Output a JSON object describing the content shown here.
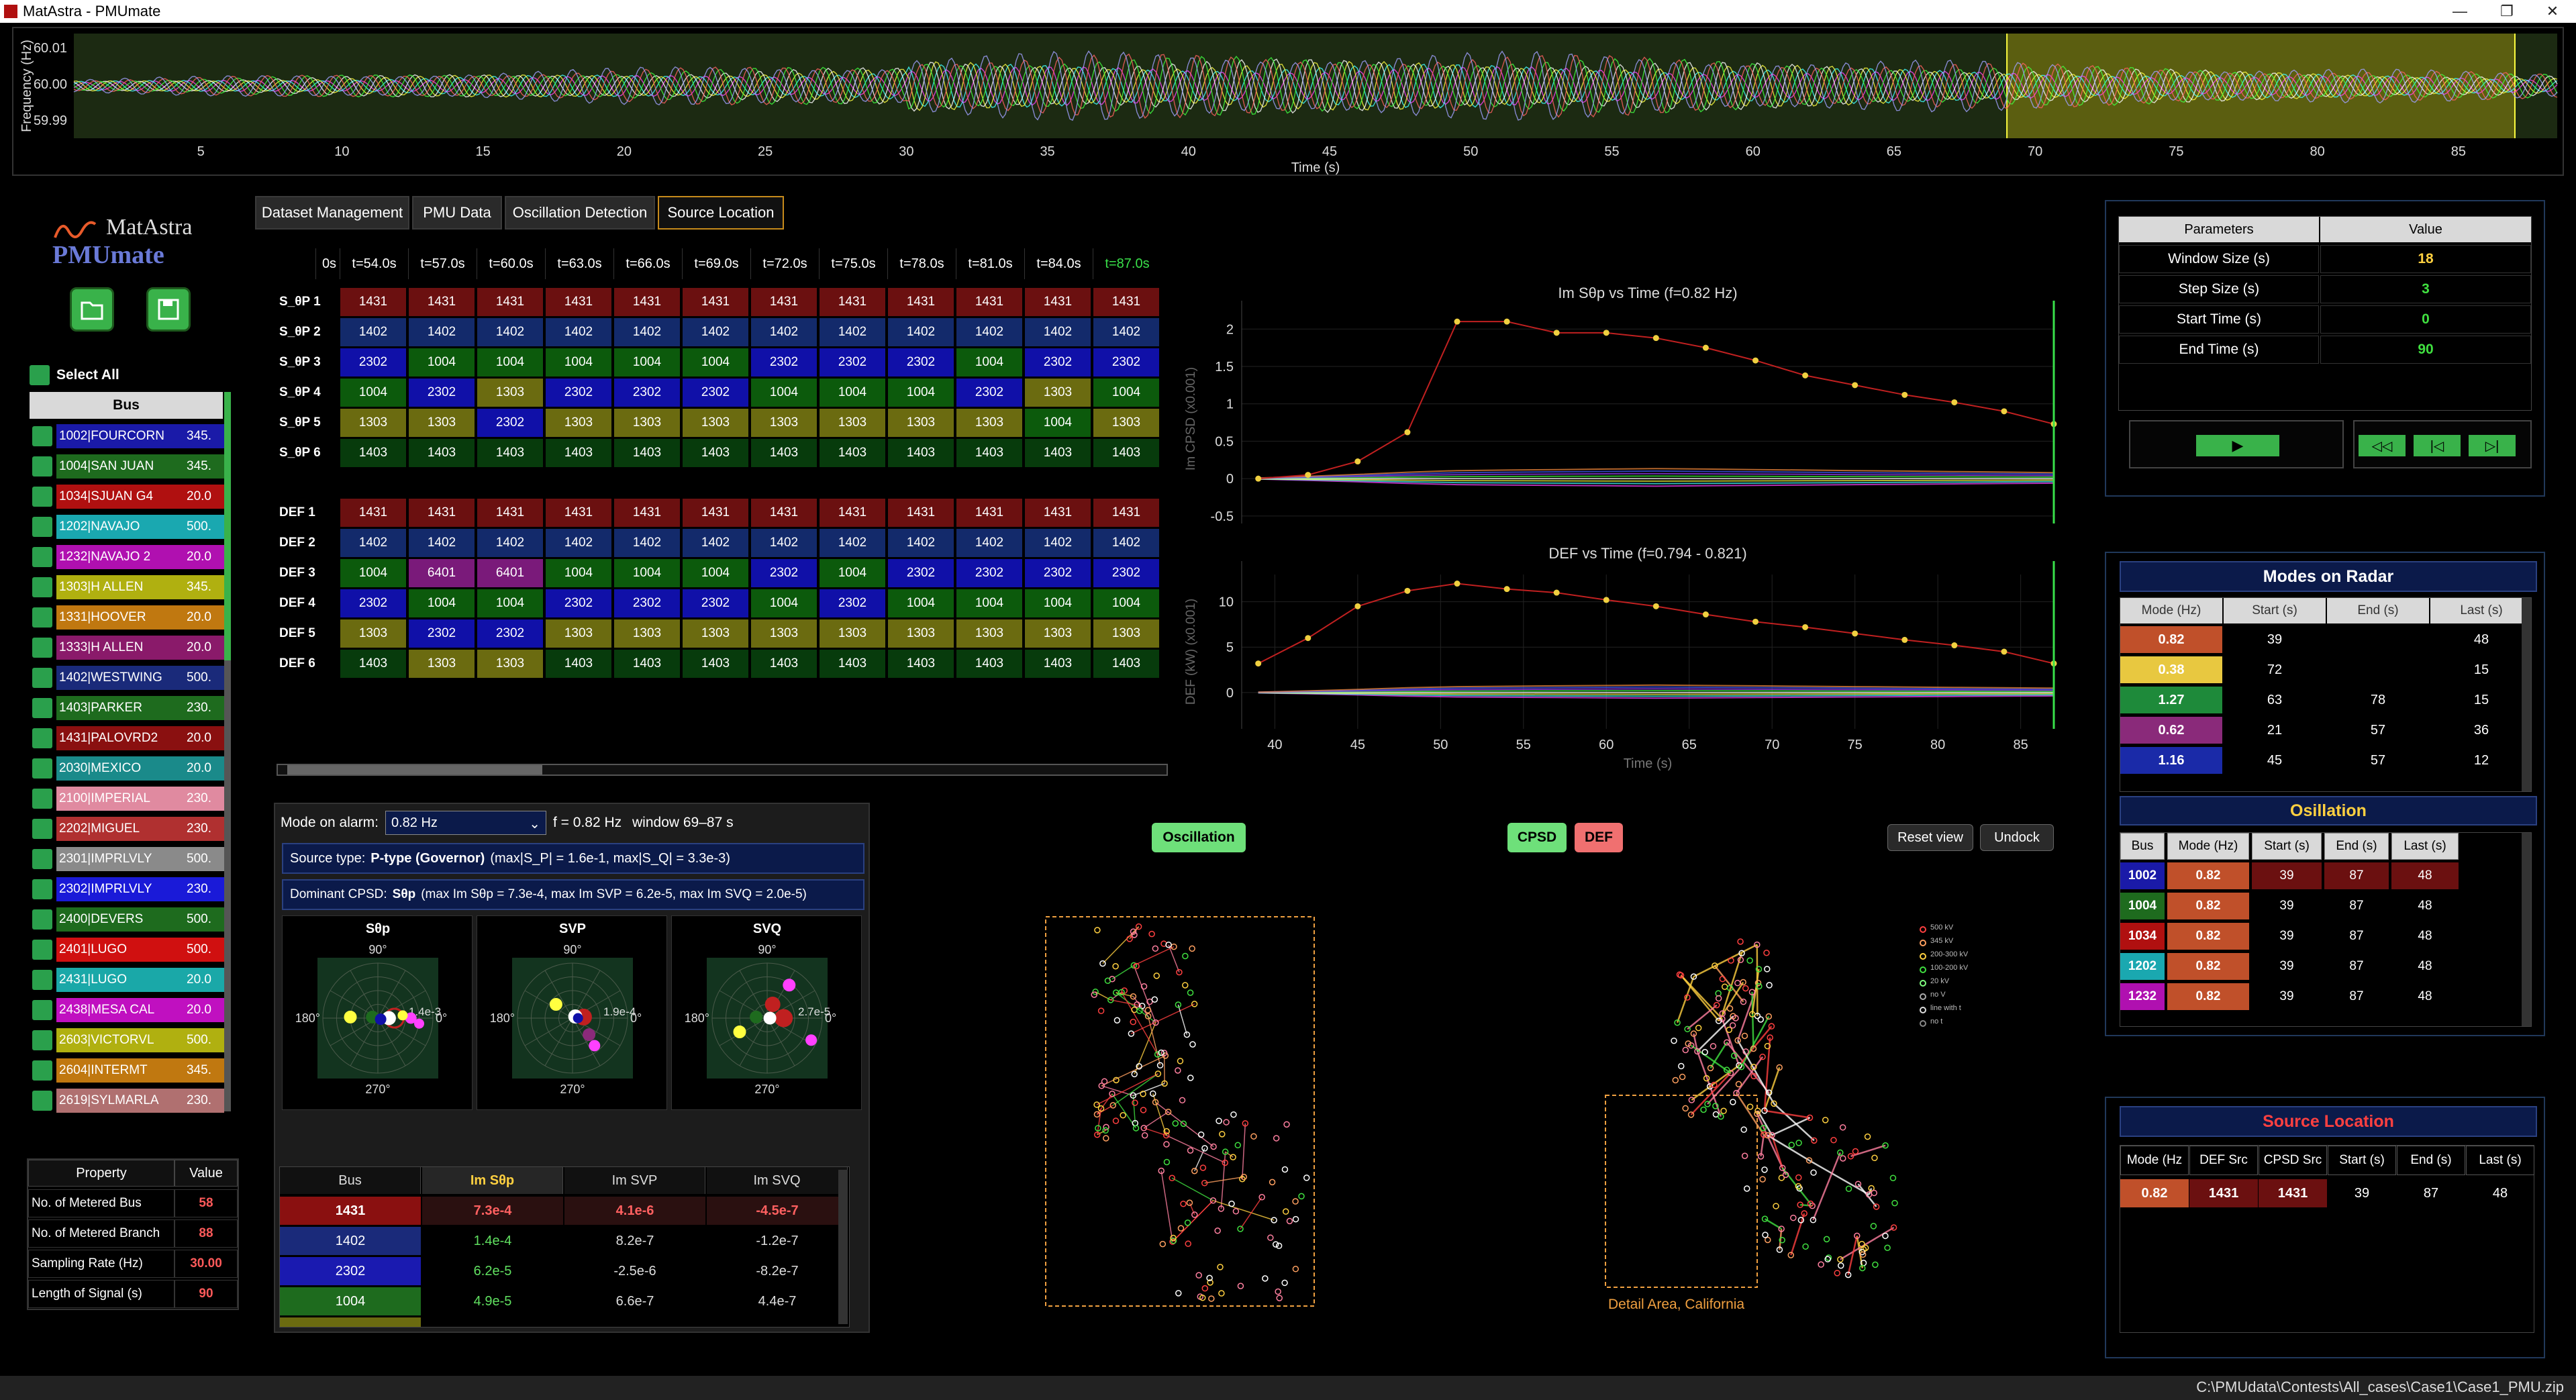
{
  "app": {
    "title": "MatAstra - PMUmate",
    "logo_top": "MatAstra",
    "logo_bottom": "PMUmate",
    "footer_path": "C:\\PMUdata\\Contests\\All_cases\\Case1\\Case1_PMU.zip"
  },
  "freq_strip": {
    "ylabel": "Frequency (Hz)",
    "yticks": [
      "60.01",
      "60.00",
      "59.99"
    ],
    "xlabel": "Time (s)",
    "xticks": [
      "5",
      "10",
      "15",
      "20",
      "25",
      "30",
      "35",
      "40",
      "45",
      "50",
      "55",
      "60",
      "65",
      "70",
      "75",
      "80",
      "85"
    ],
    "highlight": [
      69,
      87
    ]
  },
  "tabs": [
    {
      "label": "Dataset Management"
    },
    {
      "label": "PMU Data"
    },
    {
      "label": "Oscillation Detection"
    },
    {
      "label": "Source Location",
      "active": true
    }
  ],
  "select_all": "Select All",
  "bus_header": "Bus",
  "buses": [
    {
      "name": "1002|FOURCORN",
      "kv": "345.",
      "color": "#1a1aa8"
    },
    {
      "name": "1004|SAN JUAN",
      "kv": "345.",
      "color": "#1e6b1e"
    },
    {
      "name": "1034|SJUAN G4",
      "kv": "20.0",
      "color": "#b01010"
    },
    {
      "name": "1202|NAVAJO",
      "kv": "500.",
      "color": "#1aa8b0"
    },
    {
      "name": "1232|NAVAJO 2",
      "kv": "20.0",
      "color": "#b010b0"
    },
    {
      "name": "1303|H ALLEN",
      "kv": "345.",
      "color": "#b0b010"
    },
    {
      "name": "1331|HOOVER",
      "kv": "20.0",
      "color": "#c07810"
    },
    {
      "name": "1333|H ALLEN",
      "kv": "20.0",
      "color": "#8a1a6a"
    },
    {
      "name": "1402|WESTWING",
      "kv": "500.",
      "color": "#1a2a7a"
    },
    {
      "name": "1403|PARKER",
      "kv": "230.",
      "color": "#1e6b1e"
    },
    {
      "name": "1431|PALOVRD2",
      "kv": "20.0",
      "color": "#8a1010"
    },
    {
      "name": "2030|MEXICO",
      "kv": "20.0",
      "color": "#1a8a8a"
    },
    {
      "name": "2100|IMPERIAL",
      "kv": "230.",
      "color": "#e08aa0"
    },
    {
      "name": "2202|MIGUEL",
      "kv": "230.",
      "color": "#b03030"
    },
    {
      "name": "2301|IMPRLVLY",
      "kv": "500.",
      "color": "#8a8a8a"
    },
    {
      "name": "2302|IMPRLVLY",
      "kv": "230.",
      "color": "#1a1ad8"
    },
    {
      "name": "2400|DEVERS",
      "kv": "500.",
      "color": "#1e6b1e"
    },
    {
      "name": "2401|LUGO",
      "kv": "500.",
      "color": "#d01010"
    },
    {
      "name": "2431|LUGO",
      "kv": "20.0",
      "color": "#1aa8a8"
    },
    {
      "name": "2438|MESA CAL",
      "kv": "20.0",
      "color": "#c010c0"
    },
    {
      "name": "2603|VICTORVL",
      "kv": "500.",
      "color": "#b0b010"
    },
    {
      "name": "2604|INTERMT",
      "kv": "345.",
      "color": "#c07810"
    },
    {
      "name": "2619|SYLMARLA",
      "kv": "230.",
      "color": "#b07070"
    }
  ],
  "props": {
    "header": [
      "Property",
      "Value"
    ],
    "rows": [
      [
        "No. of Metered Bus",
        "58"
      ],
      [
        "No. of Metered Branch",
        "88"
      ],
      [
        "Sampling Rate (Hz)",
        "30.00"
      ],
      [
        "Length of Signal (s)",
        "90"
      ]
    ]
  },
  "grid": {
    "headers": [
      "0s",
      "t=54.0s",
      "t=57.0s",
      "t=60.0s",
      "t=63.0s",
      "t=66.0s",
      "t=69.0s",
      "t=72.0s",
      "t=75.0s",
      "t=78.0s",
      "t=81.0s",
      "t=84.0s",
      "t=87.0s"
    ],
    "rows_top": [
      {
        "label": "S_θP 1",
        "cells": [
          "1431",
          "1431",
          "1431",
          "1431",
          "1431",
          "1431",
          "1431",
          "1431",
          "1431",
          "1431",
          "1431",
          "1431"
        ]
      },
      {
        "label": "S_θP 2",
        "cells": [
          "1402",
          "1402",
          "1402",
          "1402",
          "1402",
          "1402",
          "1402",
          "1402",
          "1402",
          "1402",
          "1402",
          "1402"
        ]
      },
      {
        "label": "S_θP 3",
        "cells": [
          "2302",
          "1004",
          "1004",
          "1004",
          "1004",
          "1004",
          "2302",
          "2302",
          "2302",
          "1004",
          "2302",
          "2302"
        ]
      },
      {
        "label": "S_θP 4",
        "cells": [
          "1004",
          "2302",
          "1303",
          "2302",
          "2302",
          "2302",
          "1004",
          "1004",
          "1004",
          "2302",
          "1303",
          "1004"
        ]
      },
      {
        "label": "S_θP 5",
        "cells": [
          "1303",
          "1303",
          "2302",
          "1303",
          "1303",
          "1303",
          "1303",
          "1303",
          "1303",
          "1303",
          "1004",
          "1303"
        ]
      },
      {
        "label": "S_θP 6",
        "cells": [
          "1403",
          "1403",
          "1403",
          "1403",
          "1403",
          "1403",
          "1403",
          "1403",
          "1403",
          "1403",
          "1403",
          "1403"
        ]
      }
    ],
    "rows_bot": [
      {
        "label": "DEF 1",
        "cells": [
          "1431",
          "1431",
          "1431",
          "1431",
          "1431",
          "1431",
          "1431",
          "1431",
          "1431",
          "1431",
          "1431",
          "1431"
        ]
      },
      {
        "label": "DEF 2",
        "cells": [
          "1402",
          "1402",
          "1402",
          "1402",
          "1402",
          "1402",
          "1402",
          "1402",
          "1402",
          "1402",
          "1402",
          "1402"
        ]
      },
      {
        "label": "DEF 3",
        "cells": [
          "1004",
          "6401",
          "6401",
          "1004",
          "1004",
          "1004",
          "2302",
          "1004",
          "2302",
          "2302",
          "2302",
          "2302"
        ]
      },
      {
        "label": "DEF 4",
        "cells": [
          "2302",
          "1004",
          "1004",
          "2302",
          "2302",
          "2302",
          "1004",
          "2302",
          "1004",
          "1004",
          "1004",
          "1004"
        ]
      },
      {
        "label": "DEF 5",
        "cells": [
          "1303",
          "2302",
          "2302",
          "1303",
          "1303",
          "1303",
          "1303",
          "1303",
          "1303",
          "1303",
          "1303",
          "1303"
        ]
      },
      {
        "label": "DEF 6",
        "cells": [
          "1403",
          "1303",
          "1303",
          "1403",
          "1403",
          "1403",
          "1403",
          "1403",
          "1403",
          "1403",
          "1403",
          "1403"
        ]
      }
    ]
  },
  "chart_data": [
    {
      "type": "line",
      "title": "Im Sθp vs Time (f=0.82 Hz)",
      "ylabel": "Im CPSD (x0.001)",
      "xlim": [
        38,
        87
      ],
      "ylim": [
        -0.6,
        2.2
      ],
      "yticks": [
        "2",
        "1.5",
        "1",
        "0.5",
        "0",
        "-0.5"
      ],
      "series": [
        {
          "x": [
            39,
            42,
            45,
            48,
            51,
            54,
            57,
            60,
            63,
            66,
            69,
            72,
            75,
            78,
            81,
            84,
            87
          ],
          "values": [
            0.0,
            0.05,
            0.23,
            0.62,
            2.1,
            2.1,
            1.95,
            1.95,
            1.88,
            1.75,
            1.58,
            1.38,
            1.25,
            1.12,
            1.02,
            0.9,
            0.73
          ]
        }
      ]
    },
    {
      "type": "line",
      "title": "DEF vs Time (f=0.794 - 0.821)",
      "xlabel": "Time (s)",
      "ylabel": "DEF (kW) (x0.001)",
      "xlim": [
        38,
        87
      ],
      "ylim": [
        -4,
        13
      ],
      "yticks": [
        "10",
        "5",
        "0"
      ],
      "xticks": [
        "40",
        "45",
        "50",
        "55",
        "60",
        "65",
        "70",
        "75",
        "80",
        "85"
      ],
      "series": [
        {
          "x": [
            39,
            42,
            45,
            48,
            51,
            54,
            57,
            60,
            63,
            66,
            69,
            72,
            75,
            78,
            81,
            84,
            87
          ],
          "values": [
            3.2,
            6.0,
            9.5,
            11.2,
            12.0,
            11.4,
            11.0,
            10.2,
            9.5,
            8.6,
            7.8,
            7.2,
            6.5,
            5.8,
            5.2,
            4.5,
            3.2
          ]
        }
      ]
    }
  ],
  "mode_alarm": {
    "label": "Mode on alarm:",
    "value": "0.82 Hz",
    "freq": "f = 0.82 Hz",
    "window": "window 69–87 s"
  },
  "source_type": {
    "prefix": "Source type:",
    "type": "P-type (Governor)",
    "detail": "(max|S_P| = 1.6e-1, max|S_Q| = 3.3e-3)"
  },
  "dominant": {
    "prefix": "Dominant CPSD:",
    "name": "Sθp",
    "detail": "(max Im Sθp = 7.3e-4, max Im SVP = 6.2e-5, max Im SVQ = 2.0e-5)"
  },
  "polars": [
    {
      "title": "Sθp",
      "mag": "1.4e-3"
    },
    {
      "title": "SVP",
      "mag": "1.9e-4"
    },
    {
      "title": "SVQ",
      "mag": "2.7e-5"
    }
  ],
  "polar_ticks": {
    "top": "90°",
    "bottom": "270°",
    "left": "180°",
    "right": "0°"
  },
  "cpsd_table": {
    "header": [
      "Bus",
      "Im Sθp",
      "Im SVP",
      "Im SVQ"
    ],
    "rows": [
      {
        "bus": "1431",
        "a": "7.3e-4",
        "b": "4.1e-6",
        "c": "-4.5e-7",
        "color": "#8a1010"
      },
      {
        "bus": "1402",
        "a": "1.4e-4",
        "b": "8.2e-7",
        "c": "-1.2e-7",
        "color": "#1a2a7a"
      },
      {
        "bus": "2302",
        "a": "6.2e-5",
        "b": "-2.5e-6",
        "c": "-8.2e-7",
        "color": "#1a1ab0"
      },
      {
        "bus": "1004",
        "a": "4.9e-5",
        "b": "6.6e-7",
        "c": "4.4e-7",
        "color": "#1e6b1e"
      }
    ]
  },
  "map_btns": {
    "osc": "Oscillation",
    "cpsd": "CPSD",
    "def": "DEF",
    "reset": "Reset view",
    "undock": "Undock"
  },
  "map_legend": [
    "500 kV",
    "345 kV",
    "200-300 kV",
    "100-200 kV",
    "20 kV",
    "no V",
    "line with t",
    "no t"
  ],
  "detail_area": "Detail Area, California",
  "params": {
    "header": [
      "Parameters",
      "Value"
    ],
    "rows": [
      [
        "Window Size (s)",
        "18"
      ],
      [
        "Step Size (s)",
        "3"
      ],
      [
        "Start Time (s)",
        "0"
      ],
      [
        "End Time (s)",
        "90"
      ]
    ]
  },
  "modes": {
    "title": "Modes on Radar",
    "header": [
      "Mode (Hz)",
      "Start (s)",
      "End (s)",
      "Last (s)"
    ],
    "rows": [
      {
        "m": "0.82",
        "s": "39",
        "e": "",
        "l": "48",
        "color": "#c0502a"
      },
      {
        "m": "0.38",
        "s": "72",
        "e": "",
        "l": "15",
        "color": "#e8c840"
      },
      {
        "m": "1.27",
        "s": "63",
        "e": "78",
        "l": "15",
        "color": "#1e8a3a"
      },
      {
        "m": "0.62",
        "s": "21",
        "e": "57",
        "l": "36",
        "color": "#8a2a7a"
      },
      {
        "m": "1.16",
        "s": "45",
        "e": "57",
        "l": "12",
        "color": "#1a2aa8"
      }
    ]
  },
  "oscil": {
    "title": "Osillation",
    "header": [
      "Bus",
      "Mode (Hz)",
      "Start (s)",
      "End (s)",
      "Last (s)"
    ],
    "rows": [
      {
        "b": "1002",
        "m": "0.82",
        "s": "39",
        "e": "87",
        "l": "48",
        "color": "#1a1aa8"
      },
      {
        "b": "1004",
        "m": "0.82",
        "s": "39",
        "e": "87",
        "l": "48",
        "color": "#1e6b1e"
      },
      {
        "b": "1034",
        "m": "0.82",
        "s": "39",
        "e": "87",
        "l": "48",
        "color": "#b01010"
      },
      {
        "b": "1202",
        "m": "0.82",
        "s": "39",
        "e": "87",
        "l": "48",
        "color": "#1aa8b0"
      },
      {
        "b": "1232",
        "m": "0.82",
        "s": "39",
        "e": "87",
        "l": "48",
        "color": "#b010b0"
      }
    ]
  },
  "srcloc": {
    "title": "Source Location",
    "header": [
      "Mode (Hz",
      "DEF Src",
      "CPSD Src",
      "Start (s)",
      "End (s)",
      "Last (s)"
    ],
    "row": [
      "0.82",
      "1431",
      "1431",
      "39",
      "87",
      "48"
    ]
  }
}
